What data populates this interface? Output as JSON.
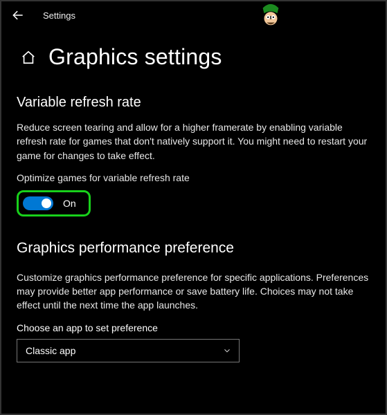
{
  "topbar": {
    "title": "Settings"
  },
  "page": {
    "title": "Graphics settings"
  },
  "vrr": {
    "heading": "Variable refresh rate",
    "description": "Reduce screen tearing and allow for a higher framerate by enabling variable refresh rate for games that don't natively support it. You might need to restart your game for changes to take effect.",
    "toggle_label": "Optimize games for variable refresh rate",
    "toggle_state": "On"
  },
  "perf": {
    "heading": "Graphics performance preference",
    "description": "Customize graphics performance preference for specific applications. Preferences may provide better app performance or save battery life. Choices may not take effect until the next time the app launches.",
    "choose_label": "Choose an app to set preference",
    "selected": "Classic app"
  },
  "colors": {
    "accent": "#0078d4",
    "highlight": "#18d01b"
  }
}
